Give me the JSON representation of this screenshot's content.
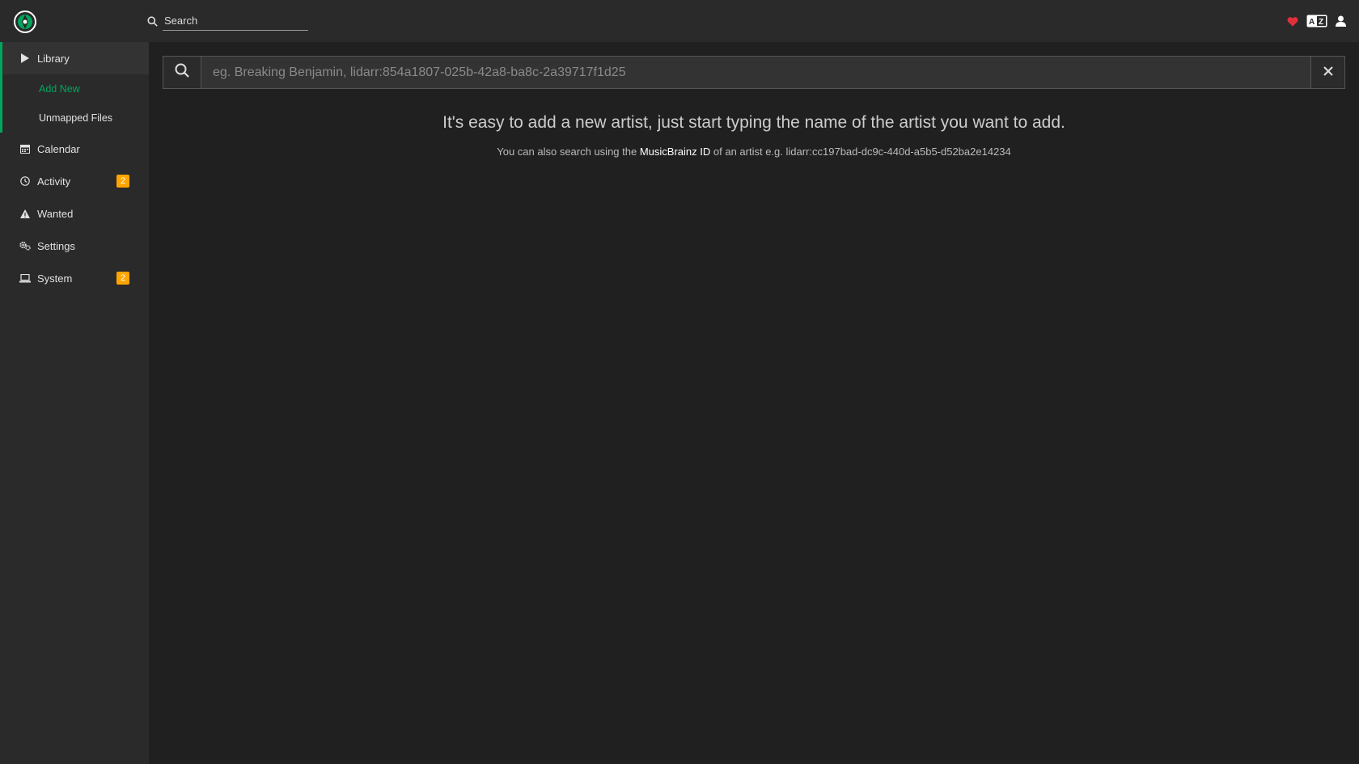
{
  "header": {
    "search_placeholder": "Search"
  },
  "sidebar": {
    "items": [
      {
        "label": "Library",
        "icon": "play-icon"
      },
      {
        "label": "Calendar",
        "icon": "calendar-icon"
      },
      {
        "label": "Activity",
        "icon": "clock-icon",
        "badge": "2"
      },
      {
        "label": "Wanted",
        "icon": "warning-icon"
      },
      {
        "label": "Settings",
        "icon": "gears-icon"
      },
      {
        "label": "System",
        "icon": "laptop-icon",
        "badge": "2"
      }
    ],
    "library_sub": [
      {
        "label": "Add New",
        "selected": true
      },
      {
        "label": "Unmapped Files",
        "selected": false
      }
    ]
  },
  "main": {
    "artist_search_placeholder": "eg. Breaking Benjamin, lidarr:854a1807-025b-42a8-ba8c-2a39717f1d25",
    "help_title": "It's easy to add a new artist, just start typing the name of the artist you want to add.",
    "help_sub_prefix": "You can also search using the",
    "help_sub_link": "MusicBrainz ID",
    "help_sub_suffix": "of an artist e.g. lidarr:cc197bad-dc9c-440d-a5b5-d52ba2e14234"
  },
  "colors": {
    "accent": "#00a65b",
    "badge": "#ffa500",
    "heart": "#e0303c"
  }
}
